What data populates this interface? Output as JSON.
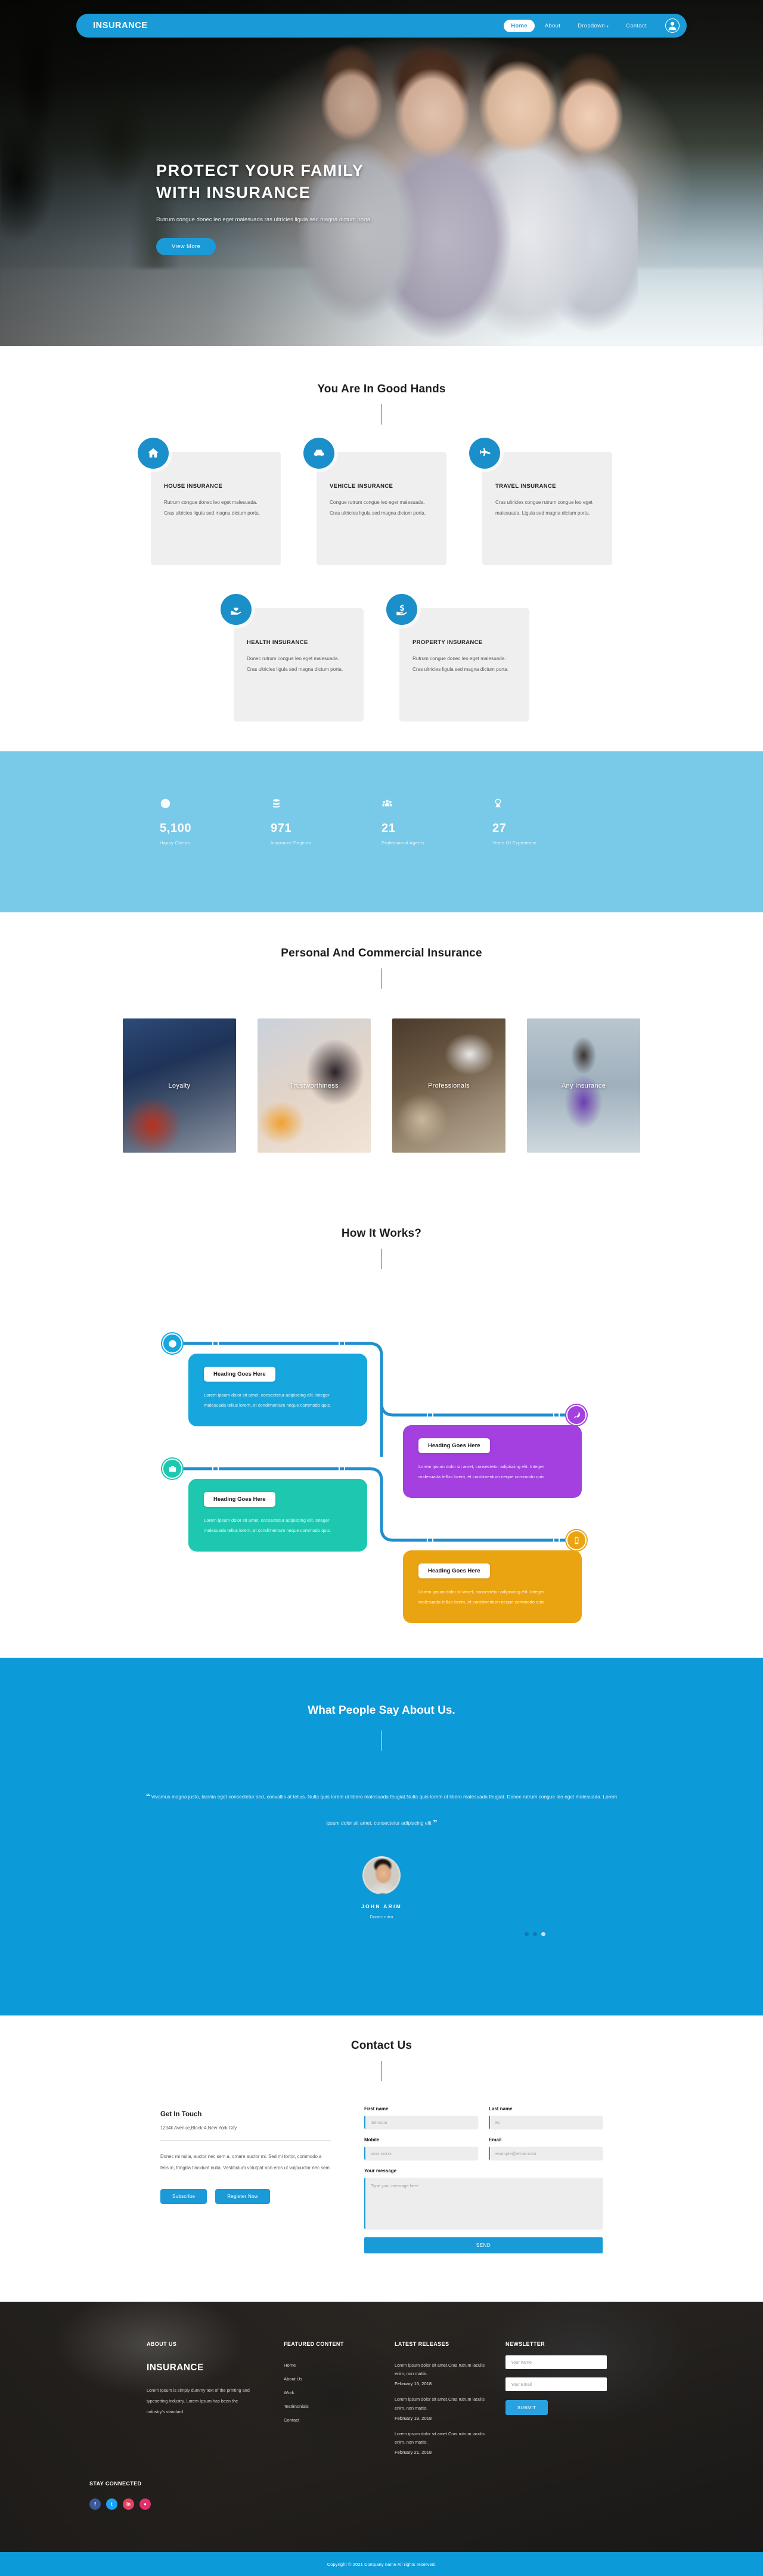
{
  "nav": {
    "brand": "INSURANCE",
    "items": [
      {
        "label": "Home",
        "active": true
      },
      {
        "label": "About",
        "active": false
      },
      {
        "label": "Dropdown",
        "active": false,
        "caret": "▾"
      },
      {
        "label": "Contact",
        "active": false
      }
    ],
    "user_icon": "user-account-icon"
  },
  "hero": {
    "title_line1": "PROTECT YOUR FAMILY",
    "title_line2": "WITH INSURANCE",
    "subtitle": "Rutrum congue donec leo eget malesuada ras ultricies ligula sed magna dictum porta.",
    "cta": "View More"
  },
  "services": {
    "heading": "You Are In Good Hands",
    "cards": [
      {
        "icon": "house-icon",
        "title": "HOUSE INSURANCE",
        "text": "Rutrum congue donec leo eget malesuada. Cras ultricies ligula sed magna dictum porta."
      },
      {
        "icon": "car-icon",
        "title": "VEHICLE INSURANCE",
        "text": "Congue rutrum congue leo eget malesuada. Cras ultricies ligula sed magna dictum porta."
      },
      {
        "icon": "plane-icon",
        "title": "TRAVEL INSURANCE",
        "text": "Cras ultricies congue rutrum congue leo eget malesuada. Ligula sed magna dictum porta."
      },
      {
        "icon": "heart-hand-icon",
        "title": "HEALTH INSURANCE",
        "text": "Donec rutrum congue leo eget malesuada. Cras ultricies ligula sed magna dictum porta."
      },
      {
        "icon": "money-hand-icon",
        "title": "PROPERTY INSURANCE",
        "text": "Rutrum congue donec leo eget malesuada. Cras ultricies ligula sed magna dictum porta."
      }
    ]
  },
  "stats": [
    {
      "icon": "smiley-icon",
      "number": "5,100",
      "label": "Happy Clients"
    },
    {
      "icon": "database-icon",
      "number": "971",
      "label": "Insurance Projects"
    },
    {
      "icon": "people-icon",
      "number": "21",
      "label": "Professional Agents"
    },
    {
      "icon": "award-icon",
      "number": "27",
      "label": "Years Of Experience"
    }
  ],
  "gallery": {
    "heading": "Personal And Commercial Insurance",
    "items": [
      {
        "label": "Loyalty"
      },
      {
        "label": "Trustworthiness"
      },
      {
        "label": "Professionals"
      },
      {
        "label": "Any Insurance"
      }
    ]
  },
  "how": {
    "heading": "How It Works?",
    "steps": [
      {
        "icon": "globe-icon",
        "heading": "Heading Goes Here",
        "text": "Lorem ipsum dolor sit amet, consectetur adipiscing elit. Integer malesuada tellus lorem, et condimentum neque commodo quis.",
        "color": "#16a7de"
      },
      {
        "icon": "rocket-icon",
        "heading": "Heading Goes Here",
        "text": "Lorem ipsum dolor sit amet, consectetur adipiscing elit. Integer malesuada tellus lorem, et condimentum neque commodo quis.",
        "color": "#a43fe0"
      },
      {
        "icon": "briefcase-icon",
        "heading": "Heading Goes Here",
        "text": "Lorem ipsum dolor sit amet, consectetur adipiscing elit. Integer malesuada tellus lorem, et condimentum neque commodo quis.",
        "color": "#1ec8b0"
      },
      {
        "icon": "mobile-icon",
        "heading": "Heading Goes Here",
        "text": "Lorem ipsum dolor sit amet, consectetur adipiscing elit. Integer malesuada tellus lorem, et condimentum neque commodo quis.",
        "color": "#eaa412"
      }
    ]
  },
  "testimonials": {
    "heading": "What People Say About Us.",
    "quote_line1": "Vivamus magna justo, lacinia eget consectetur sed, convallis at tellus. Nulla quis lorem ut libero",
    "quote_line2": "malesuada feugiat.Nulla quis lorem ut libero malesuada feugiat. Donec rutrum congue leo eget malesuada.",
    "quote_line3": "Lorem ipsum dolor sit amet, consectetur adipiscing elit",
    "open_quote": "“",
    "close_quote": "”",
    "author": "JOHN ARIM",
    "role": "Donec rutru",
    "dots": 3,
    "active_dot": 3
  },
  "contact": {
    "heading": "Contact Us",
    "left_title": "Get In Touch",
    "address": "1234k Avenue,Block-4,New York City.",
    "body": "Donec mi nulla, auctor nec sem a, ornare auctor mi. Sed mi tortor, commodo a felis in, fringilla tincidunt nulla. Vestibulum volutpat non eros ut vulpuuctor nec sem",
    "buttons": [
      {
        "label": "Subscribe"
      },
      {
        "label": "Register Now"
      }
    ],
    "fields": [
      {
        "label": "First name",
        "placeholder": "Johnson"
      },
      {
        "label": "Last name",
        "placeholder": "Kc"
      },
      {
        "label": "Mobile",
        "placeholder": "xxxx xxxxx"
      },
      {
        "label": "Email",
        "placeholder": "example@email.com"
      }
    ],
    "message_label": "Your message",
    "message_placeholder": "Type your message here",
    "send": "SEND"
  },
  "footer": {
    "about": {
      "heading": "ABOUT US",
      "brand": "INSURANCE",
      "text": "Lorem Ipsum is simply dummy text of the printing and typesetting industry. Lorem Ipsum has been the industry's standard."
    },
    "featured": {
      "heading": "FEATURED CONTENT",
      "links": [
        "Home",
        "About Us",
        "Work",
        "Testimonials",
        "Contact"
      ]
    },
    "releases": {
      "heading": "LATEST RELEASES",
      "items": [
        {
          "text": "Lorem ipsum dolor sit amet.Cras rutrum iaculis enim, non mattis.",
          "date": "February 15, 2018"
        },
        {
          "text": "Lorem ipsum dolor sit amet.Cras rutrum iaculis enim, non mattis.",
          "date": "February 18, 2018"
        },
        {
          "text": "Lorem ipsum dolor sit amet.Cras rutrum iaculis enim, non mattis.",
          "date": "February 21, 2018"
        }
      ]
    },
    "newsletter": {
      "heading": "NEWSLETTER",
      "name_placeholder": "Your name",
      "email_placeholder": "Your Email",
      "submit": "SUBMIT"
    },
    "social": {
      "heading": "STAY CONNECTED",
      "items": [
        {
          "name": "facebook-icon",
          "glyph": "f",
          "color": "#3b5998"
        },
        {
          "name": "twitter-icon",
          "glyph": "t",
          "color": "#1da1f2"
        },
        {
          "name": "linkedin-icon",
          "glyph": "in",
          "color": "#e4405f"
        },
        {
          "name": "instagram-icon",
          "glyph": "●",
          "color": "#e1306c"
        }
      ]
    },
    "copyright": "Copyright © 2021 Company name All rights reserved."
  },
  "colors": {
    "brand_blue": "#1a9ad6",
    "light_blue": "#79c9e8",
    "testi_blue": "#0d9ad9",
    "green": "#1ec8b0",
    "purple": "#a43fe0",
    "amber": "#eaa412"
  }
}
